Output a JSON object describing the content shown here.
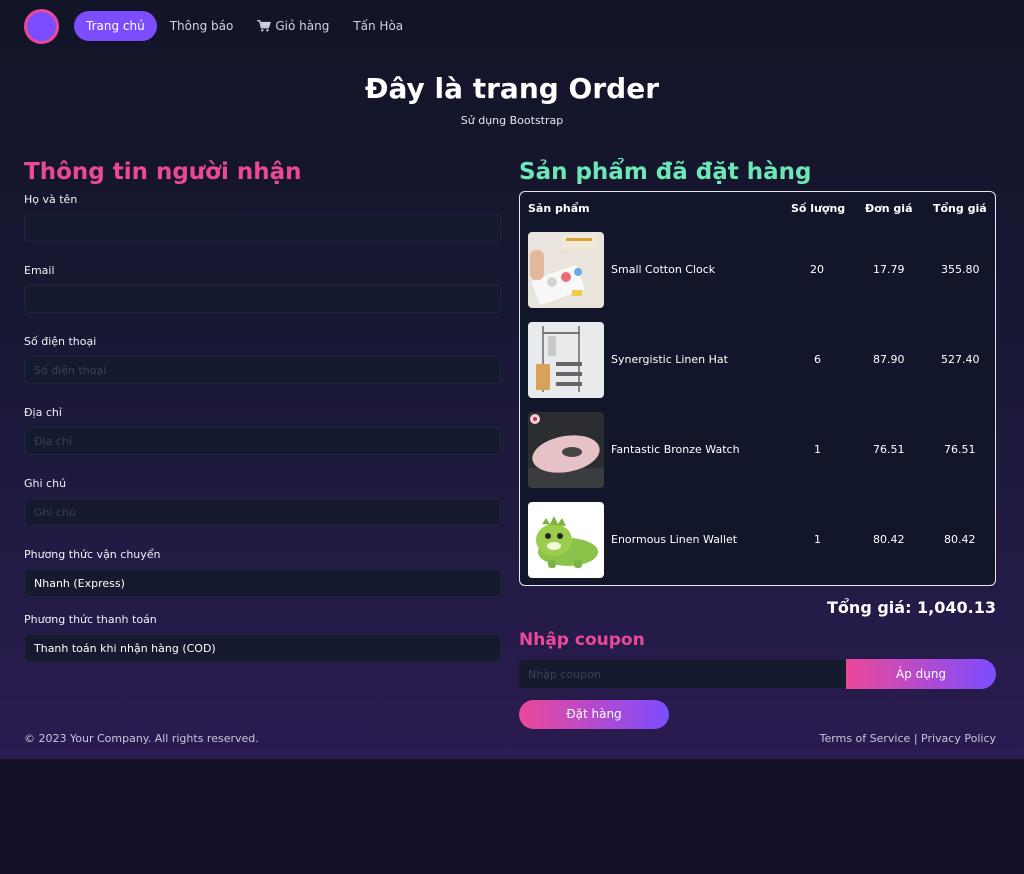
{
  "nav": {
    "items": [
      {
        "label": "Trang chủ",
        "active": true
      },
      {
        "label": "Thông báo"
      },
      {
        "label": "Giỏ hàng",
        "icon": "cart-icon"
      },
      {
        "label": "Tấn Hòa"
      }
    ]
  },
  "hero": {
    "title": "Đây là trang Order",
    "subtitle": "Sử dụng Bootstrap"
  },
  "recipient": {
    "title": "Thông tin người nhận",
    "fields": {
      "name": {
        "label": "Họ và tên",
        "value": "",
        "placeholder": ""
      },
      "email": {
        "label": "Email",
        "value": "",
        "placeholder": ""
      },
      "phone": {
        "label": "Số điện thoại",
        "value": "",
        "placeholder": "Số điện thoại"
      },
      "address": {
        "label": "Địa chỉ",
        "value": "",
        "placeholder": "Địa chỉ"
      },
      "note": {
        "label": "Ghi chú",
        "value": "",
        "placeholder": "Ghi chú"
      }
    },
    "shipping": {
      "label": "Phương thức vận chuyển",
      "selected": "Nhanh (Express)"
    },
    "payment": {
      "label": "Phương thức thanh toán",
      "selected": "Thanh toán khi nhận hàng (COD)"
    }
  },
  "order": {
    "title": "Sản phẩm đã đặt hàng",
    "headers": {
      "product": "Sản phẩm",
      "qty": "Số lượng",
      "price": "Đơn giá",
      "total": "Tổng giá"
    },
    "rows": [
      {
        "name": "Small Cotton Clock",
        "qty": "20",
        "price": "17.79",
        "total": "355.80"
      },
      {
        "name": "Synergistic Linen Hat",
        "qty": "6",
        "price": "87.90",
        "total": "527.40"
      },
      {
        "name": "Fantastic Bronze Watch",
        "qty": "1",
        "price": "76.51",
        "total": "76.51"
      },
      {
        "name": "Enormous Linen Wallet",
        "qty": "1",
        "price": "80.42",
        "total": "80.42"
      }
    ],
    "grand_total": "Tổng giá: 1,040.13"
  },
  "coupon": {
    "title": "Nhập coupon",
    "placeholder": "Nhập coupon",
    "apply_label": "Áp dụng"
  },
  "submit_label": "Đặt hàng",
  "footer": {
    "copyright": "© 2023 Your Company. All rights reserved.",
    "terms": "Terms of Service",
    "separator": "|",
    "privacy": "Privacy Policy"
  },
  "colors": {
    "accent_purple": "#7c4dff",
    "accent_pink": "#ec4899",
    "accent_green": "#6ee7b7"
  }
}
